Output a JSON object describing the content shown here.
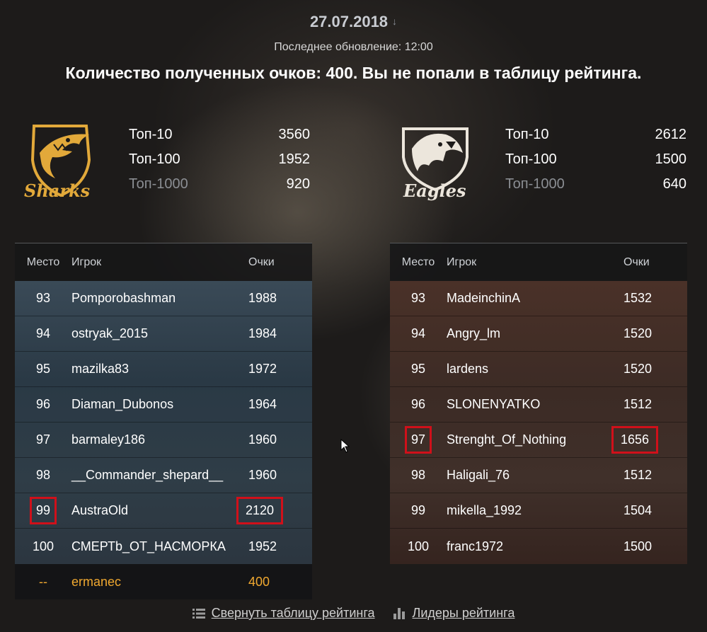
{
  "header": {
    "date": "27.07.2018",
    "last_update": "Последнее обновление: 12:00",
    "headline": "Количество полученных очков: 400. Вы не попали в таблицу рейтинга."
  },
  "sharks": {
    "logo_text": "Sharks",
    "tops": [
      {
        "label": "Топ-10",
        "value": "3560"
      },
      {
        "label": "Топ-100",
        "value": "1952"
      },
      {
        "label": "Топ-1000",
        "value": "920"
      }
    ],
    "columns": {
      "place": "Место",
      "player": "Игрок",
      "points": "Очки"
    },
    "rows": [
      {
        "place": "93",
        "player": "Pomporobashman",
        "points": "1988"
      },
      {
        "place": "94",
        "player": "ostryak_2015",
        "points": "1984"
      },
      {
        "place": "95",
        "player": "mazilka83",
        "points": "1972"
      },
      {
        "place": "96",
        "player": "Diaman_Dubonos",
        "points": "1964"
      },
      {
        "place": "97",
        "player": "barmaley186",
        "points": "1960"
      },
      {
        "place": "98",
        "player": "__Commander_shepard__",
        "points": "1960"
      },
      {
        "place": "99",
        "player": "AustraOld",
        "points": "2120"
      },
      {
        "place": "100",
        "player": "СМЕРТb_ОТ_НАСМОРКА",
        "points": "1952"
      }
    ],
    "me": {
      "place": "--",
      "player": "ermanec",
      "points": "400"
    }
  },
  "eagles": {
    "logo_text": "Eagles",
    "tops": [
      {
        "label": "Топ-10",
        "value": "2612"
      },
      {
        "label": "Топ-100",
        "value": "1500"
      },
      {
        "label": "Топ-1000",
        "value": "640"
      }
    ],
    "columns": {
      "place": "Место",
      "player": "Игрок",
      "points": "Очки"
    },
    "rows": [
      {
        "place": "93",
        "player": "MadeinchinA",
        "points": "1532"
      },
      {
        "place": "94",
        "player": "Angry_lm",
        "points": "1520"
      },
      {
        "place": "95",
        "player": "lardens",
        "points": "1520"
      },
      {
        "place": "96",
        "player": "SLONENYATKO",
        "points": "1512"
      },
      {
        "place": "97",
        "player": "Strenght_Of_Nothing",
        "points": "1656"
      },
      {
        "place": "98",
        "player": "Haligali_76",
        "points": "1512"
      },
      {
        "place": "99",
        "player": "mikella_1992",
        "points": "1504"
      },
      {
        "place": "100",
        "player": "franc1972",
        "points": "1500"
      }
    ]
  },
  "footer": {
    "collapse_label": "Свернуть таблицу рейтинга",
    "leaders_label": "Лидеры рейтинга"
  },
  "colors": {
    "highlight": "#d0101a",
    "me_row": "#f0a830",
    "sharks_gold": "#e2a93a",
    "eagles_cream": "#ece6dc"
  }
}
